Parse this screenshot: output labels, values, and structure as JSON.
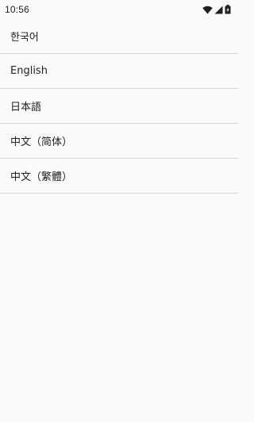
{
  "status_bar": {
    "time": "10:56",
    "icons": [
      "wifi-icon",
      "cellular-signal-icon",
      "battery-icon"
    ]
  },
  "languages": [
    {
      "label": "한국어"
    },
    {
      "label": "English"
    },
    {
      "label": "日本語"
    },
    {
      "label": "中文（简体）"
    },
    {
      "label": "中文（繁體）"
    }
  ],
  "colors": {
    "background": "#fafafa",
    "divider": "#d6d6d6",
    "text": "#212121"
  }
}
